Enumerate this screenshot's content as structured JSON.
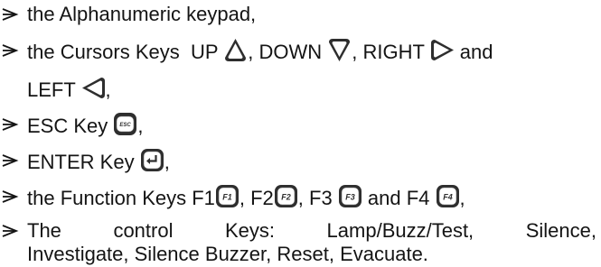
{
  "items": [
    {
      "text": "the Alphanumeric keypad,"
    },
    {
      "prefix": "the Cursors Keys  UP ",
      "up_icon": "cursor-up-key-icon",
      "mid1": ", DOWN ",
      "down_icon": "cursor-down-key-icon",
      "mid2": ", RIGHT ",
      "right_icon": "cursor-right-key-icon",
      "suffix": " and",
      "cont_prefix": "LEFT ",
      "left_icon": "cursor-left-key-icon",
      "cont_suffix": ","
    },
    {
      "prefix": "ESC Key ",
      "icon": "esc-key-icon",
      "icon_label": "ESC",
      "suffix": ","
    },
    {
      "prefix": "ENTER Key ",
      "icon": "enter-key-icon",
      "suffix": ","
    },
    {
      "prefix": "the Function Keys F1",
      "f1_label": "F1",
      "mid1": ", F2",
      "f2_label": "F2",
      "mid2": ", F3 ",
      "f3_label": "F3",
      "mid3": " and F4 ",
      "f4_label": "F4",
      "suffix": ","
    },
    {
      "words": [
        "The",
        "control",
        "Keys:",
        "Lamp/Buzz/Test,",
        "Silence,"
      ],
      "cont": "Investigate, Silence Buzzer, Reset, Evacuate."
    }
  ]
}
